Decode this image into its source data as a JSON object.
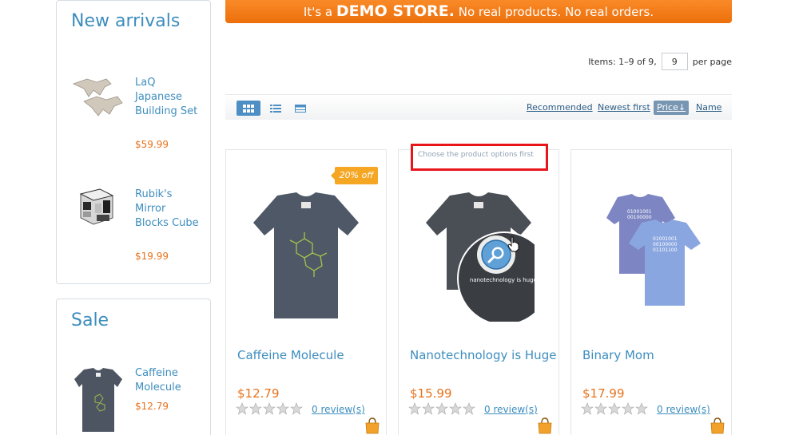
{
  "banner": {
    "prefix": "It's a",
    "emphasis": "DEMO STORE.",
    "suffix": "No real products. No real orders."
  },
  "sidebar": {
    "new_arrivals": {
      "title": "New arrivals",
      "items": [
        {
          "name": "LaQ Japanese Building Set",
          "price": "$59.99"
        },
        {
          "name": "Rubik's Mirror Blocks Cube",
          "price": "$19.99"
        }
      ]
    },
    "sale": {
      "title": "Sale",
      "items": [
        {
          "name": "Caffeine Molecule",
          "price": "$12.79"
        }
      ]
    }
  },
  "pager": {
    "items_text": "Items: 1–9 of 9,",
    "per_page_value": "9",
    "per_page_label": "per page"
  },
  "toolbar": {
    "views": [
      "grid-view-icon",
      "list-view-icon",
      "table-view-icon"
    ],
    "sort_options": [
      "Recommended",
      "Newest first",
      "Price",
      "Name"
    ],
    "active_sort": "Price",
    "active_sort_arrow": "↓"
  },
  "products": [
    {
      "name": "Caffeine Molecule",
      "price": "$12.79",
      "reviews": "0 review(s)",
      "badge": "20% off",
      "rating": 0
    },
    {
      "name": "Nanotechnology is Huge",
      "price": "$15.99",
      "reviews": "0 review(s)",
      "tooltip": "Choose the product options first",
      "rating": 0
    },
    {
      "name": "Binary Mom",
      "price": "$17.99",
      "reviews": "0 review(s)",
      "rating": 0
    }
  ],
  "colors": {
    "accent": "#3d8dbe",
    "price": "#e8721c",
    "banner": "#f07b14",
    "highlight": "#e8161b"
  }
}
